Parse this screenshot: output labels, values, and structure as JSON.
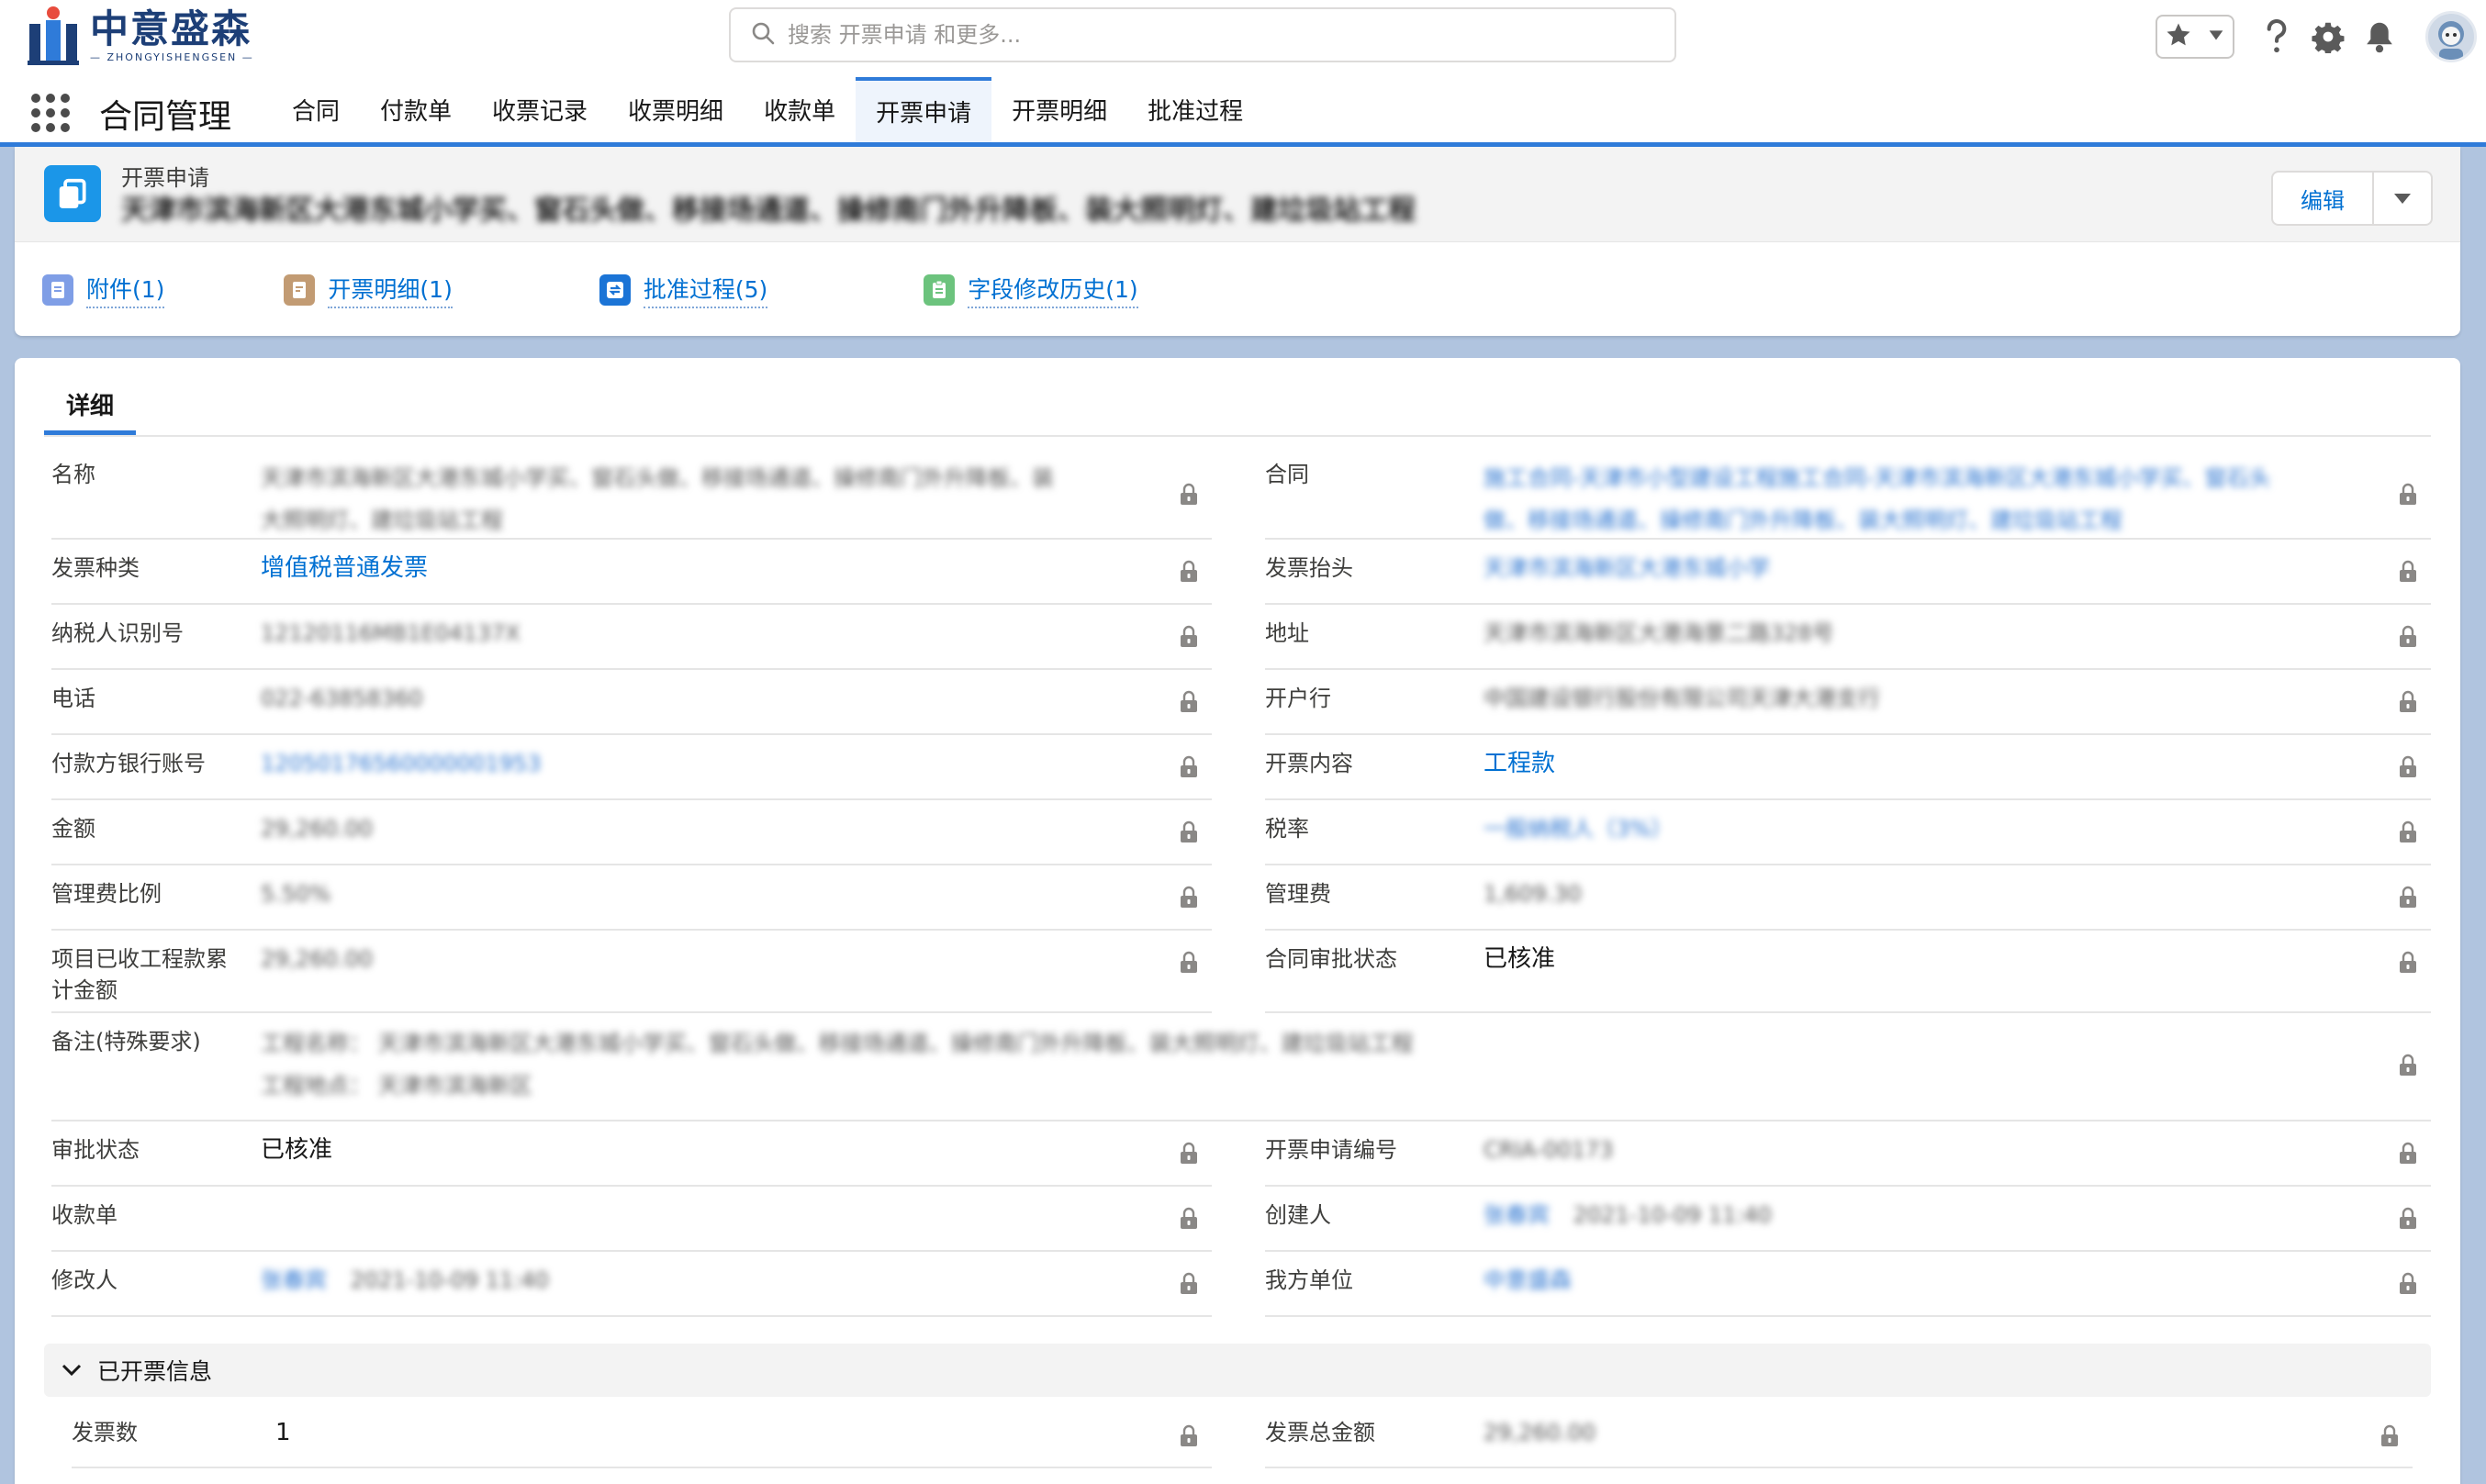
{
  "logo": {
    "cn": "中意盛森",
    "en": "ZHONGYISHENGSEN"
  },
  "search": {
    "placeholder": "搜索 开票申请 和更多..."
  },
  "app": {
    "name": "合同管理"
  },
  "nav": {
    "tabs": [
      "合同",
      "付款单",
      "收票记录",
      "收票明细",
      "收款单",
      "开票申请",
      "开票明细",
      "批准过程"
    ],
    "active_index": 5
  },
  "record": {
    "type_label": "开票申请",
    "title": "天津市滨海新区大港东城小学买、窗石头做、移接场通道、操修南门外升降板、装大照明灯、建垃圾站工程",
    "edit_label": "编辑"
  },
  "related": [
    {
      "label": "附件(1)",
      "color": "#7f9ee6"
    },
    {
      "label": "开票明细(1)",
      "color": "#c29b73"
    },
    {
      "label": "批准过程(5)",
      "color": "#1b74d6"
    },
    {
      "label": "字段修改历史(1)",
      "color": "#6cc37d"
    }
  ],
  "detail": {
    "tab_label": "详细",
    "fields": {
      "name": {
        "label": "名称",
        "line1": "天津市滨海新区大港东城小学买、窗石头做、移接场通道、操修南门外升降板、装",
        "line2": "大照明灯、建垃圾站工程"
      },
      "contract": {
        "label": "合同",
        "line1": "施工合同-天津市小型建设工程施工合同-天津市滨海新区大港东城小学买、窗石头",
        "line2": "做、移接场通道、操修南门外升降板、装大照明灯、建垃圾站工程"
      },
      "invoice_type": {
        "label": "发票种类",
        "value": "增值税普通发票"
      },
      "invoice_title": {
        "label": "发票抬头",
        "value": "天津市滨海新区大港东城小学"
      },
      "taxpayer_id": {
        "label": "纳税人识别号",
        "value": "12120116MB1E04137X"
      },
      "address": {
        "label": "地址",
        "value": "天津市滨海新区大港海景二路328号"
      },
      "phone": {
        "label": "电话",
        "value": "022-63858360"
      },
      "bank": {
        "label": "开户行",
        "value": "中国建设银行股份有限公司天津大港支行"
      },
      "payer_account": {
        "label": "付款方银行账号",
        "value": "12050176560000001953"
      },
      "content": {
        "label": "开票内容",
        "value": "工程款"
      },
      "amount": {
        "label": "金额",
        "value": "29,260.00"
      },
      "tax_rate": {
        "label": "税率",
        "value": "一般纳税人（3%）"
      },
      "mgmt_ratio": {
        "label": "管理费比例",
        "value": "5.50%"
      },
      "mgmt_fee": {
        "label": "管理费",
        "value": "1,609.30"
      },
      "collected_total": {
        "label1": "项目已收工程款累",
        "label2": "计金额",
        "value": "29,260.00"
      },
      "contract_status": {
        "label": "合同审批状态",
        "value": "已核准"
      },
      "remark": {
        "label": "备注(特殊要求)",
        "line1": "工程名称：  天津市滨海新区大港东城小学买、窗石头做、移接场通道、操修南门外升降板、装大照明灯、建垃圾站工程",
        "line2": "工程地点：  天津市滨海新区"
      },
      "approval_status": {
        "label": "审批状态",
        "value": "已核准"
      },
      "request_no": {
        "label": "开票申请编号",
        "value": "CRIA-00173"
      },
      "receipt": {
        "label": "收款单",
        "value": ""
      },
      "creator": {
        "label": "创建人",
        "user": "张春宾",
        "time": "2021-10-09 11:40"
      },
      "modifier": {
        "label": "修改人",
        "user": "张春宾",
        "time": "2021-10-09 11:40"
      },
      "our_unit": {
        "label": "我方单位",
        "value": "中意盛森"
      }
    },
    "section": {
      "title": "已开票信息",
      "invoice_count": {
        "label": "发票数",
        "value": "1"
      },
      "invoice_total": {
        "label": "发票总金额",
        "value": "29,260.00"
      }
    }
  }
}
